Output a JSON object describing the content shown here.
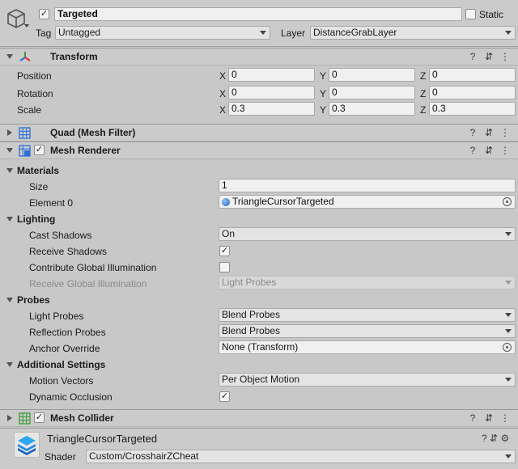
{
  "gameobject": {
    "name": "Targeted",
    "static_label": "Static",
    "tag_label": "Tag",
    "tag_value": "Untagged",
    "layer_label": "Layer",
    "layer_value": "DistanceGrabLayer"
  },
  "transform": {
    "title": "Transform",
    "position_label": "Position",
    "rotation_label": "Rotation",
    "scale_label": "Scale",
    "axis_x": "X",
    "axis_y": "Y",
    "axis_z": "Z",
    "position": {
      "x": "0",
      "y": "0",
      "z": "0"
    },
    "rotation": {
      "x": "0",
      "y": "0",
      "z": "0"
    },
    "scale": {
      "x": "0.3",
      "y": "0.3",
      "z": "0.3"
    }
  },
  "mesh_filter": {
    "title": "Quad (Mesh Filter)"
  },
  "mesh_renderer": {
    "title": "Mesh Renderer",
    "materials_label": "Materials",
    "size_label": "Size",
    "size_value": "1",
    "element0_label": "Element 0",
    "element0_value": "TriangleCursorTargeted",
    "lighting_label": "Lighting",
    "cast_shadows_label": "Cast Shadows",
    "cast_shadows_value": "On",
    "receive_shadows_label": "Receive Shadows",
    "receive_shadows_checked": true,
    "contribute_gi_label": "Contribute Global Illumination",
    "contribute_gi_checked": false,
    "receive_gi_label": "Receive Global Illumination",
    "receive_gi_value": "Light Probes",
    "probes_label": "Probes",
    "light_probes_label": "Light Probes",
    "light_probes_value": "Blend Probes",
    "reflection_probes_label": "Reflection Probes",
    "reflection_probes_value": "Blend Probes",
    "anchor_override_label": "Anchor Override",
    "anchor_override_value": "None (Transform)",
    "additional_label": "Additional Settings",
    "motion_vectors_label": "Motion Vectors",
    "motion_vectors_value": "Per Object Motion",
    "dynamic_occlusion_label": "Dynamic Occlusion",
    "dynamic_occlusion_checked": true
  },
  "mesh_collider": {
    "title": "Mesh Collider"
  },
  "material": {
    "name": "TriangleCursorTargeted",
    "shader_label": "Shader",
    "shader_value": "Custom/CrosshairZCheat"
  },
  "icons": {
    "help": "?",
    "presets": "⇵",
    "menu": "⋮",
    "check": "✓",
    "settings": "⚙"
  },
  "colors": {
    "header_bg": "#cbcbcb",
    "field_bg": "#f0f0f0",
    "panel_bg": "#c8c8c8",
    "material_icon": "#1e88e5"
  }
}
